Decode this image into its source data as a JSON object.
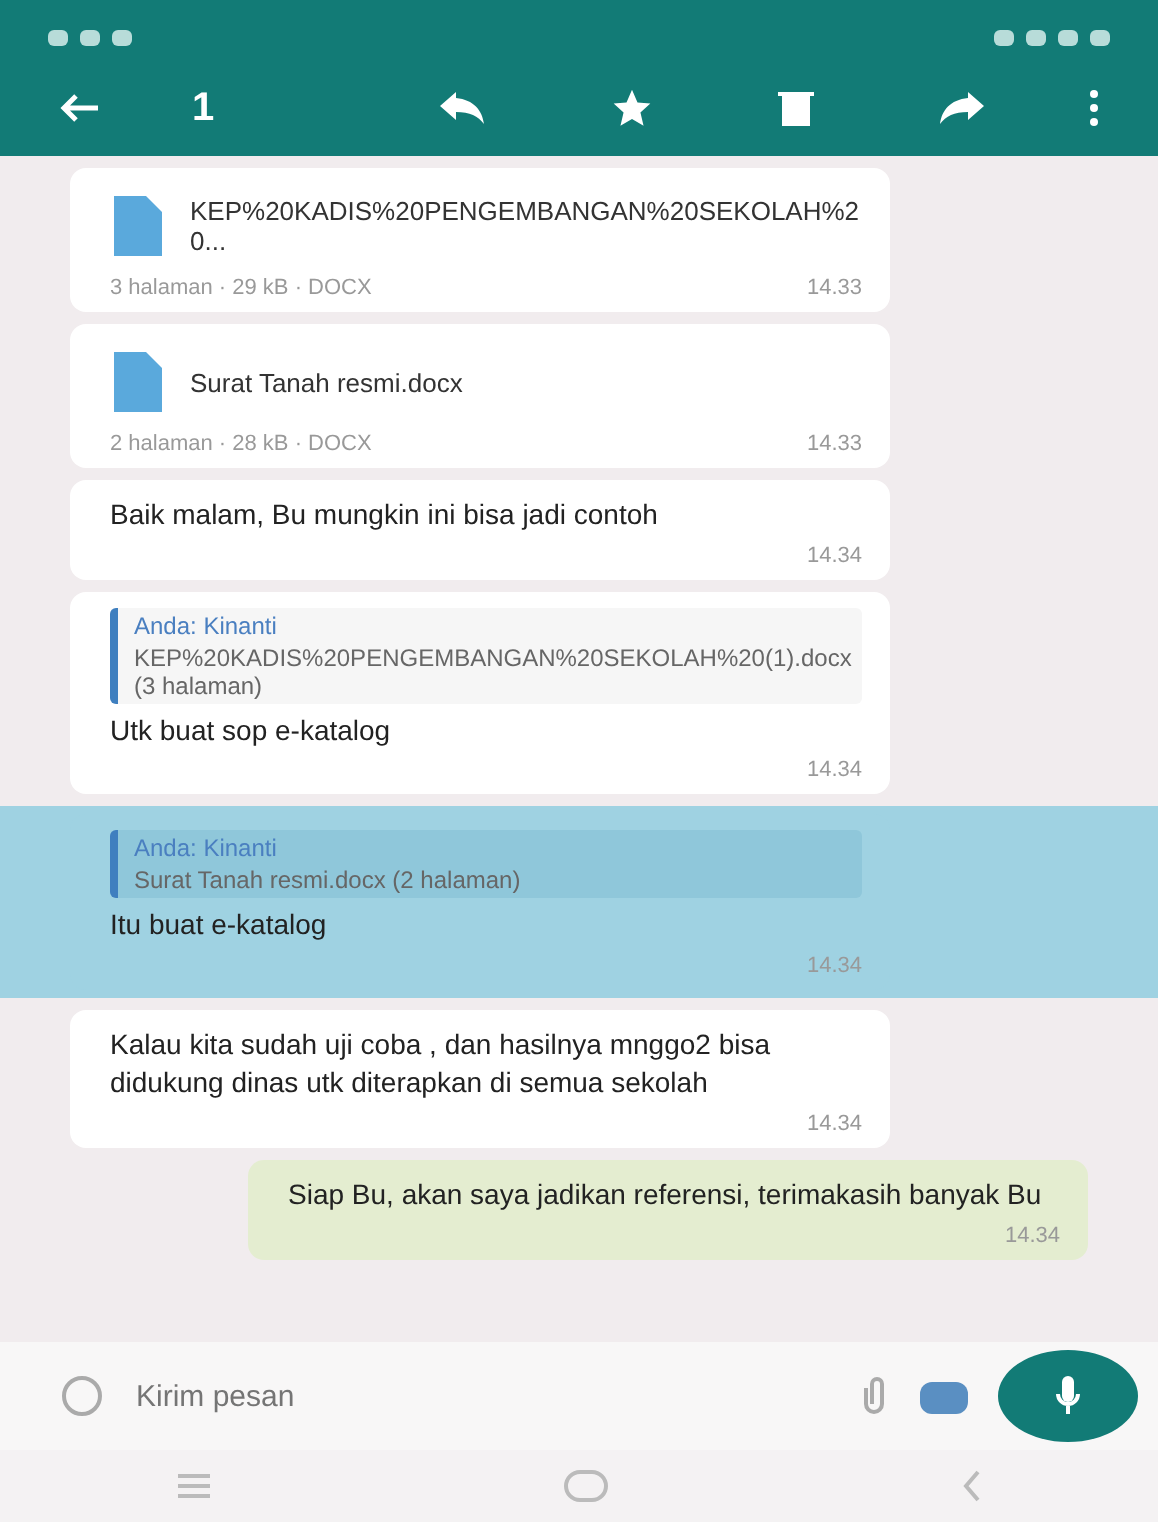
{
  "action_bar": {
    "count": "1"
  },
  "messages": [
    {
      "kind": "document",
      "outgoing": false,
      "selected": false,
      "file_name": "KEP%20KADIS%20PENGEMBANGAN%20SEKOLAH%20...",
      "meta": "3 halaman · 29 kB · DOCX",
      "time": "14.33"
    },
    {
      "kind": "document",
      "outgoing": false,
      "selected": false,
      "file_name": "Surat Tanah resmi.docx",
      "meta": "2 halaman · 28 kB · DOCX",
      "time": "14.33"
    },
    {
      "kind": "text",
      "outgoing": false,
      "selected": false,
      "text": "Baik malam,  Bu mungkin ini bisa jadi contoh",
      "time": "14.34"
    },
    {
      "kind": "reply",
      "outgoing": false,
      "selected": false,
      "quote_author": "Anda: Kinanti",
      "quote_text": "KEP%20KADIS%20PENGEMBANGAN%20SEKOLAH%20(1).docx (3 halaman)",
      "text": "Utk buat sop e-katalog",
      "time": "14.34"
    },
    {
      "kind": "reply",
      "outgoing": false,
      "selected": true,
      "quote_author": "Anda: Kinanti",
      "quote_text": "Surat Tanah resmi.docx (2 halaman)",
      "text": "Itu buat e-katalog",
      "time": "14.34"
    },
    {
      "kind": "text",
      "outgoing": false,
      "selected": false,
      "text": "Kalau kita sudah uji coba , dan hasilnya mnggo2 bisa didukung dinas utk diterapkan di semua sekolah",
      "time": "14.34"
    },
    {
      "kind": "text",
      "outgoing": true,
      "selected": false,
      "text": "Siap Bu, akan saya jadikan referensi, terimakasih banyak Bu",
      "time": "14.34"
    }
  ],
  "composer": {
    "placeholder": "Kirim pesan"
  }
}
